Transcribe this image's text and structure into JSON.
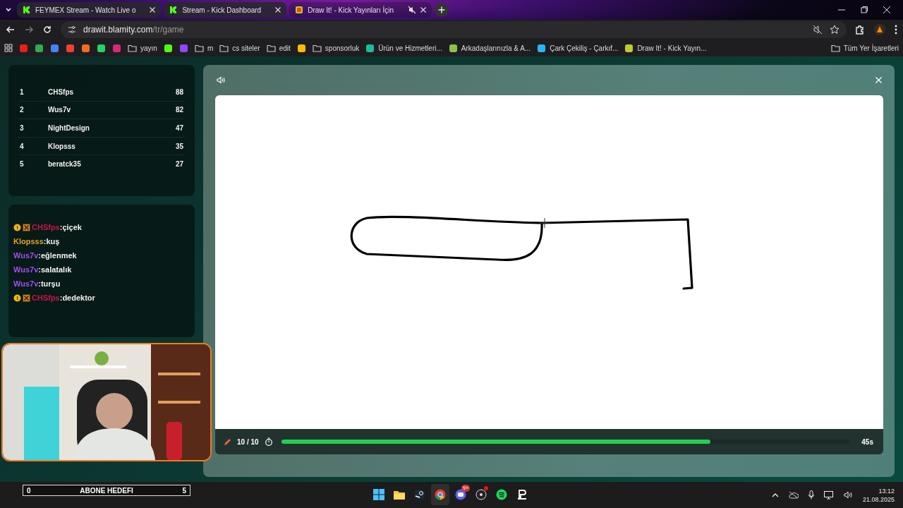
{
  "browser": {
    "tabs": [
      {
        "title": "FEYMEX Stream - Watch Live o",
        "selected": false,
        "muted": false
      },
      {
        "title": "Stream - Kick Dashboard",
        "selected": false,
        "muted": false
      },
      {
        "title": "Draw It! - Kick Yayınları İçin",
        "selected": true,
        "muted": true
      }
    ],
    "url": {
      "host": "drawit.blamity.com",
      "path": "/tr/game"
    },
    "bookmarks": [
      {
        "kind": "icon",
        "color": "#e62117"
      },
      {
        "kind": "icon",
        "color": "#34a853"
      },
      {
        "kind": "icon",
        "color": "#4285f4"
      },
      {
        "kind": "icon",
        "color": "#ea4335"
      },
      {
        "kind": "icon",
        "color": "#f36b21"
      },
      {
        "kind": "icon",
        "color": "#25d366"
      },
      {
        "kind": "icon",
        "color": "#d62976"
      },
      {
        "kind": "folder",
        "label": "yayın"
      },
      {
        "kind": "icon",
        "color": "#53fc18"
      },
      {
        "kind": "icon",
        "color": "#9146ff"
      },
      {
        "kind": "folder",
        "label": "m"
      },
      {
        "kind": "folder",
        "label": "cs siteler"
      },
      {
        "kind": "folder",
        "label": "edit"
      },
      {
        "kind": "icon",
        "color": "#fbbc04"
      },
      {
        "kind": "folder",
        "label": "sponsorluk"
      },
      {
        "kind": "site",
        "label": "Ürün ve Hizmetleri...",
        "color": "#1abc9c"
      },
      {
        "kind": "site",
        "label": "Arkadaşlarınızla & A...",
        "color": "#8bc34a"
      },
      {
        "kind": "site",
        "label": "Çark Çekiliş - Çarkıf...",
        "color": "#29b6f6"
      },
      {
        "kind": "site",
        "label": "Draw It! - Kick Yayın...",
        "color": "#c0ca33"
      }
    ],
    "all_bookmarks": "Tüm Yer İşaretleri"
  },
  "leaderboard": [
    {
      "rank": "1",
      "name": "CHSfps",
      "score": "88"
    },
    {
      "rank": "2",
      "name": "Wus7v",
      "score": "82"
    },
    {
      "rank": "3",
      "name": "NightDesign",
      "score": "47"
    },
    {
      "rank": "4",
      "name": "Klopsss",
      "score": "35"
    },
    {
      "rank": "5",
      "name": "beratck35",
      "score": "27"
    }
  ],
  "chat": [
    {
      "user": "CHSfps",
      "color": "#c8174a",
      "text": ":çiçek",
      "badges": true
    },
    {
      "user": "Klopsss",
      "color": "#e8a21f",
      "text": ":kuş",
      "badges": false
    },
    {
      "user": "Wus7v",
      "color": "#a24ff0",
      "text": ":eğlenmek",
      "badges": false
    },
    {
      "user": "Wus7v",
      "color": "#a24ff0",
      "text": ":salatalık",
      "badges": false
    },
    {
      "user": "Wus7v",
      "color": "#a24ff0",
      "text": ":turşu",
      "badges": false
    },
    {
      "user": "CHSfps",
      "color": "#c8174a",
      "text": ":dedektor",
      "badges": true
    }
  ],
  "game": {
    "round": "10 / 10",
    "timer": {
      "level": 0.754,
      "reading": "45s"
    }
  },
  "subscriber_goal": {
    "current": "0",
    "label": "ABONE HEDEFI",
    "target": "5"
  },
  "taskbar": {
    "apps": [
      {
        "kind": "start",
        "selected": false
      },
      {
        "kind": "files",
        "selected": false
      },
      {
        "kind": "steam",
        "selected": false
      },
      {
        "kind": "chrome",
        "selected": true
      },
      {
        "kind": "discord",
        "selected": false,
        "badge": "9+"
      },
      {
        "kind": "obs",
        "selected": false
      },
      {
        "kind": "spotify",
        "selected": false
      },
      {
        "kind": "launcher",
        "selected": false
      }
    ],
    "time": "13:12",
    "date": "21.08.2025"
  }
}
